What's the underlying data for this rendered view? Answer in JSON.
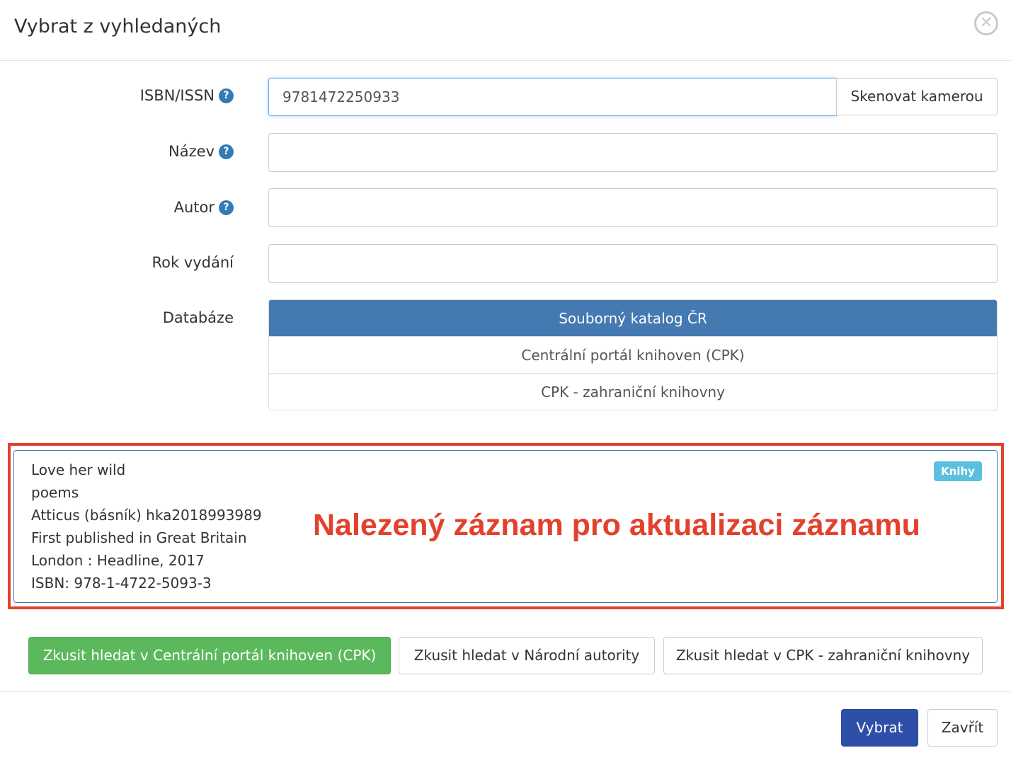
{
  "modal": {
    "title": "Vybrat z vyhledaných",
    "close_symbol": "✕"
  },
  "form": {
    "isbn": {
      "label": "ISBN/ISSN",
      "value": "9781472250933",
      "help_icon": "question-circle-icon"
    },
    "scan_button_label": "Skenovat kamerou",
    "title": {
      "label": "Název",
      "value": "",
      "help_icon": "question-circle-icon"
    },
    "author": {
      "label": "Autor",
      "value": "",
      "help_icon": "question-circle-icon"
    },
    "year": {
      "label": "Rok vydání",
      "value": ""
    },
    "database": {
      "label": "Databáze",
      "options": [
        {
          "label": "Souborný katalog ČR",
          "selected": true
        },
        {
          "label": "Centrální portál knihoven (CPK)",
          "selected": false
        },
        {
          "label": "CPK - zahraniční knihovny",
          "selected": false
        }
      ]
    }
  },
  "result": {
    "lines": [
      "Love her wild",
      "poems",
      "Atticus (básník) hka2018993989",
      "First published in Great Britain",
      "London : Headline, 2017",
      "ISBN: 978-1-4722-5093-3"
    ],
    "badge": "Knihy",
    "annotation": "Nalezený záznam pro aktualizaci záznamu"
  },
  "search_buttons": [
    "Zkusit hledat v Centrální portál knihoven (CPK)",
    "Zkusit hledat v Národní autority",
    "Zkusit hledat v CPK - zahraniční knihovny"
  ],
  "footer": {
    "select_label": "Vybrat",
    "close_label": "Zavřít"
  },
  "colors": {
    "primary": "#2e4fa7",
    "active_db": "#4479b2",
    "success": "#5cb85c",
    "annotation": "#e2412c",
    "badge": "#5bc0de"
  }
}
